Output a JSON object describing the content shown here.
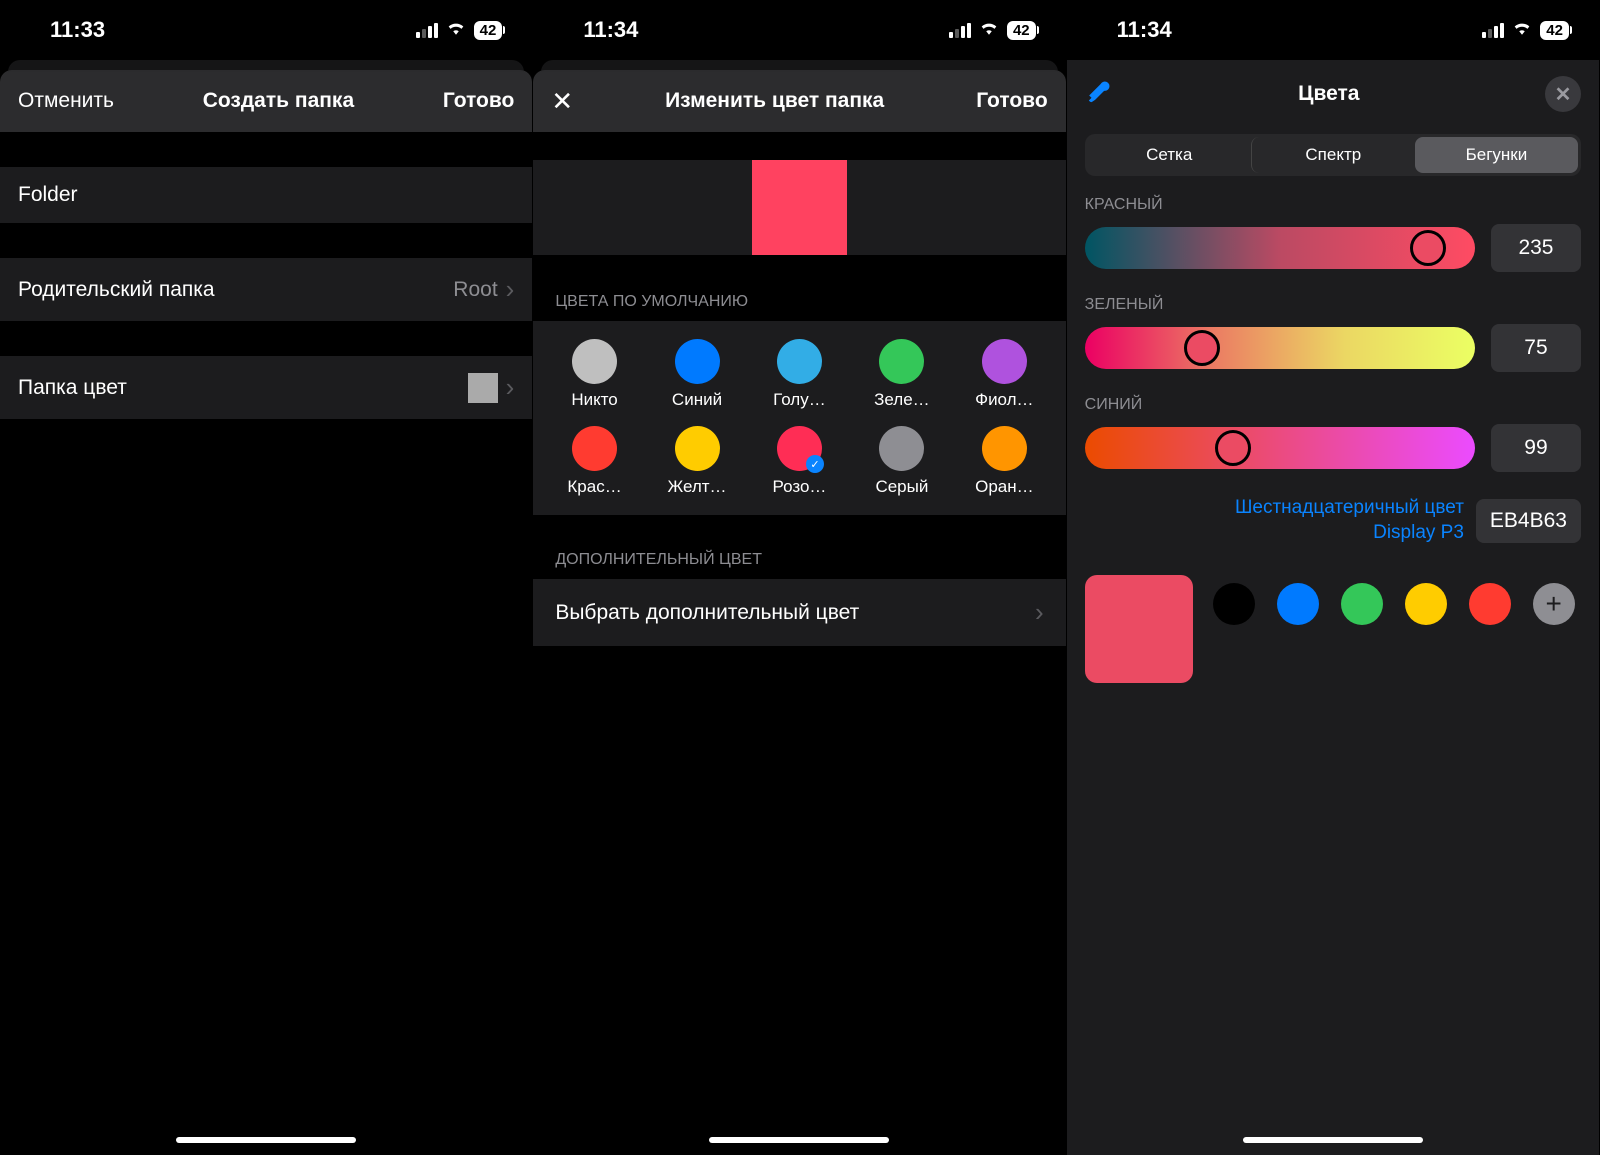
{
  "status": {
    "time1": "11:33",
    "time2": "11:34",
    "time3": "11:34",
    "battery": "42"
  },
  "s1": {
    "cancel": "Отменить",
    "title": "Создать папка",
    "done": "Готово",
    "folder_name": "Folder",
    "parent_label": "Родительский папка",
    "parent_value": "Root",
    "color_label": "Папка цвет"
  },
  "s2": {
    "title": "Изменить цвет папка",
    "done": "Готово",
    "default_header": "ЦВЕТА ПО УМОЛЧАНИЮ",
    "colors": [
      {
        "name": "Никто",
        "hex": "#bfbfbf"
      },
      {
        "name": "Синий",
        "hex": "#007aff"
      },
      {
        "name": "Голу…",
        "hex": "#32ade6"
      },
      {
        "name": "Зеле…",
        "hex": "#34c759"
      },
      {
        "name": "Фиол…",
        "hex": "#af52de"
      },
      {
        "name": "Крас…",
        "hex": "#ff3b30"
      },
      {
        "name": "Желт…",
        "hex": "#ffcc00"
      },
      {
        "name": "Розо…",
        "hex": "#ff2d55",
        "selected": true
      },
      {
        "name": "Серый",
        "hex": "#8e8e93"
      },
      {
        "name": "Оран…",
        "hex": "#ff9500"
      }
    ],
    "addl_header": "ДОПОЛНИТЕЛЬНЫЙ ЦВЕТ",
    "addl_row": "Выбрать дополнительный цвет"
  },
  "s3": {
    "title": "Цвета",
    "tabs": {
      "grid": "Сетка",
      "spectrum": "Спектр",
      "sliders": "Бегунки"
    },
    "red_label": "КРАСНЫЙ",
    "red_value": "235",
    "green_label": "ЗЕЛЕНЫЙ",
    "green_value": "75",
    "blue_label": "СИНИЙ",
    "blue_value": "99",
    "hex_link_line1": "Шестнадцатеричный цвет",
    "hex_link_line2": "Display P3",
    "hex_value": "EB4B63",
    "swatches": [
      "#000000",
      "#007aff",
      "#34c759",
      "#ffcc00",
      "#ff3b30"
    ]
  }
}
